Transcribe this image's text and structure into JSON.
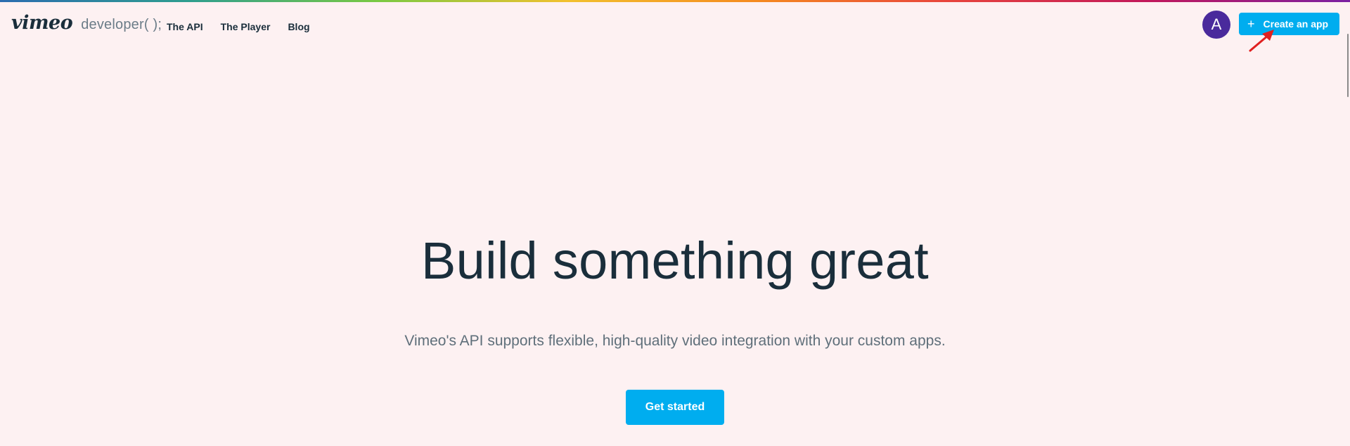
{
  "brand": {
    "logo_text": "vimeo",
    "suffix": "developer( );"
  },
  "nav": {
    "links": [
      {
        "label": "The API"
      },
      {
        "label": "The Player"
      },
      {
        "label": "Blog"
      }
    ]
  },
  "user": {
    "avatar_initial": "A",
    "avatar_color": "#4a2a9c"
  },
  "actions": {
    "create_app_icon": "plus-icon",
    "create_app_label": "Create an app",
    "accent_color": "#00adef"
  },
  "hero": {
    "title": "Build something great",
    "subtitle": "Vimeo's API supports flexible, high-quality video integration with your custom apps.",
    "cta_label": "Get started"
  },
  "annotation": {
    "icon": "red-arrow-icon",
    "color": "#e02020"
  }
}
